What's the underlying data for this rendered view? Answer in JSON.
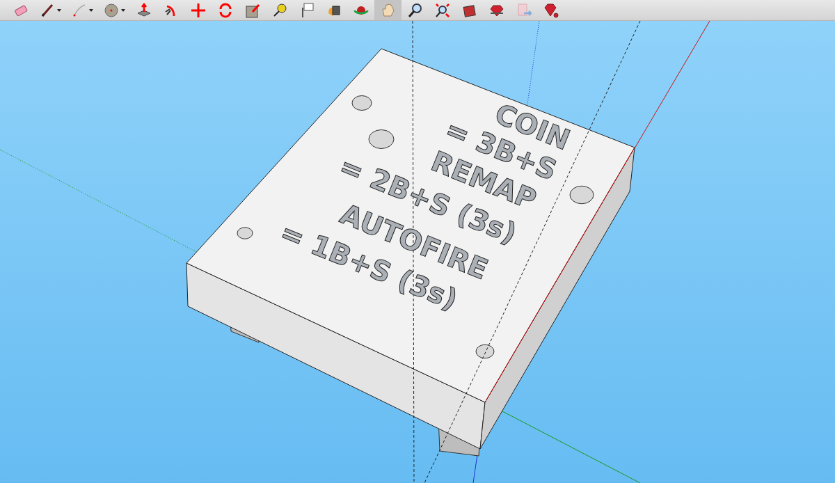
{
  "toolbar": {
    "tools": [
      {
        "kind": "eraser",
        "selected": false,
        "dropdown": false
      },
      {
        "kind": "pencil",
        "selected": false,
        "dropdown": true
      },
      {
        "kind": "arc",
        "selected": false,
        "dropdown": true
      },
      {
        "kind": "circle",
        "selected": false,
        "dropdown": true
      },
      {
        "kind": "pushpull",
        "selected": false,
        "dropdown": false
      },
      {
        "kind": "followme",
        "selected": false,
        "dropdown": false
      },
      {
        "kind": "move",
        "selected": false,
        "dropdown": false
      },
      {
        "kind": "rotate",
        "selected": false,
        "dropdown": false
      },
      {
        "kind": "scale",
        "selected": false,
        "dropdown": false
      },
      {
        "kind": "tape",
        "selected": false,
        "dropdown": false
      },
      {
        "kind": "text",
        "selected": false,
        "dropdown": false
      },
      {
        "kind": "paint",
        "selected": false,
        "dropdown": false
      },
      {
        "kind": "orbit",
        "selected": false,
        "dropdown": false
      },
      {
        "kind": "pan",
        "selected": true,
        "dropdown": false
      },
      {
        "kind": "zoom",
        "selected": false,
        "dropdown": false
      },
      {
        "kind": "zoomextents",
        "selected": false,
        "dropdown": false
      },
      {
        "kind": "warehouse",
        "selected": false,
        "dropdown": false
      },
      {
        "kind": "components",
        "selected": false,
        "dropdown": false
      },
      {
        "kind": "share",
        "selected": false,
        "dropdown": false
      },
      {
        "kind": "extensions",
        "selected": false,
        "dropdown": false
      }
    ]
  },
  "model": {
    "engraved_lines": [
      "COIN",
      "= 3B+S",
      "REMAP",
      "= 2B+S (3s)",
      "AUTOFIRE",
      "= 1B+S (3s)"
    ]
  }
}
